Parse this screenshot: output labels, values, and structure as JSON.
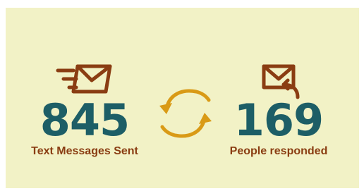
{
  "stats": {
    "sent": {
      "value": "845",
      "label": "Text Messages Sent",
      "icon": "fast-envelope-icon"
    },
    "responded": {
      "value": "169",
      "label": "People responded",
      "icon": "reply-envelope-icon"
    }
  },
  "center_icon": "cycle-arrows-icon",
  "colors": {
    "background": "#f2f2c6",
    "number": "#1d5e66",
    "label": "#8a3d12",
    "icon": "#8a3d12",
    "arrows": "#d99a16"
  }
}
